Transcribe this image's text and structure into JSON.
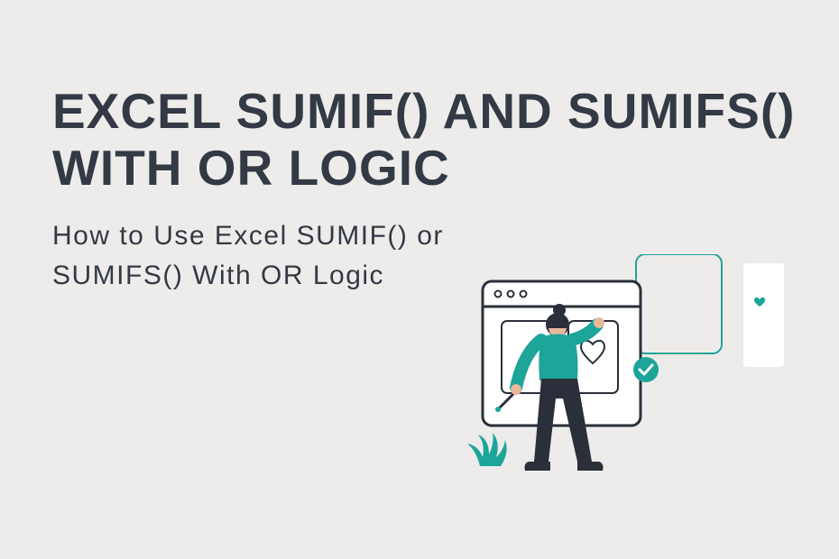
{
  "hero": {
    "title_line1": "EXCEL SUMIF() AND SUMIFS()",
    "title_line2": "WITH OR LOGIC",
    "subtitle_line1": "How to Use Excel SUMIF() or",
    "subtitle_line2": "SUMIFS() With OR Logic"
  },
  "colors": {
    "background": "#edecea",
    "text_primary": "#333a45",
    "accent_teal": "#1da599",
    "dark_navy": "#2a2f3a"
  }
}
